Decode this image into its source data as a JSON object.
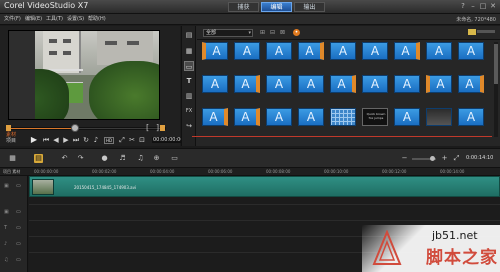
{
  "title_bar": {
    "app_title": "Corel VideoStudio X7",
    "step_tabs": [
      "捕获",
      "编辑",
      "输出"
    ],
    "active_tab_index": 1,
    "window_buttons": [
      "?",
      "–",
      "□",
      "✕"
    ]
  },
  "menu_bar": {
    "items": [
      "文件(F)",
      "编辑(E)",
      "工具(T)",
      "设置(S)",
      "帮助(H)"
    ],
    "resolution_label": "未命名, 720*480"
  },
  "player": {
    "mode_labels": [
      "项目",
      "素材"
    ],
    "timecode": "00:00:00:00",
    "hd_badge": "HD",
    "progress_fraction": 0.43
  },
  "library": {
    "category_dropdown": "全部",
    "side_icons": [
      "media-icon",
      "instant-project-icon",
      "transition-icon",
      "title-icon",
      "graphic-icon",
      "filter-icon",
      "path-icon"
    ],
    "thumbnails": [
      {
        "label": "",
        "style": "orange-left"
      },
      {
        "label": "",
        "style": "plain"
      },
      {
        "label": "",
        "style": "plain"
      },
      {
        "label": "",
        "style": "orange-edge"
      },
      {
        "label": "",
        "style": "plain"
      },
      {
        "label": "",
        "style": "plain"
      },
      {
        "label": "",
        "style": "orange-edge"
      },
      {
        "label": "",
        "style": "plain"
      },
      {
        "label": "",
        "style": "plain"
      },
      {
        "label": "",
        "style": "plain"
      },
      {
        "label": "",
        "style": "orange-edge"
      },
      {
        "label": "",
        "style": "plain"
      },
      {
        "label": "",
        "style": "plain"
      },
      {
        "label": "",
        "style": "orange-edge"
      },
      {
        "label": "",
        "style": "plain"
      },
      {
        "label": "",
        "style": "plain"
      },
      {
        "label": "",
        "style": "orange-left"
      },
      {
        "label": "",
        "style": "orange-edge"
      },
      {
        "label": "",
        "style": "orange-edge"
      },
      {
        "label": "",
        "style": "orange-edge"
      },
      {
        "label": "",
        "style": "plain"
      },
      {
        "label": "",
        "style": "plain"
      },
      {
        "label": "",
        "style": "grid-pattern"
      },
      {
        "label": "",
        "style": "black-frame",
        "inner_text": "Quick brown fox jumps"
      },
      {
        "label": "",
        "style": "plain"
      },
      {
        "label": "",
        "style": "dark-gray"
      },
      {
        "label": "",
        "style": "plain"
      }
    ]
  },
  "timeline": {
    "track_label": "项目 素材",
    "ruler_times": [
      "00:00:00:00",
      "00:00:02:00",
      "00:00:04:00",
      "00:00:06:00",
      "00:00:08:00",
      "00:00:10:00",
      "00:00:12:00",
      "00:00:14:00"
    ],
    "clip_name": "20150415_174845_174903.avi",
    "toolbar_timecode": "0:00:14:10"
  },
  "watermark": {
    "site": "jb51.net",
    "name": "脚本之家"
  },
  "colors": {
    "accent_orange": "#e0892a",
    "tab_blue": "#2d6fc0",
    "clip_teal": "#2a8a7f",
    "thumb_blue": "#2a85d6"
  }
}
